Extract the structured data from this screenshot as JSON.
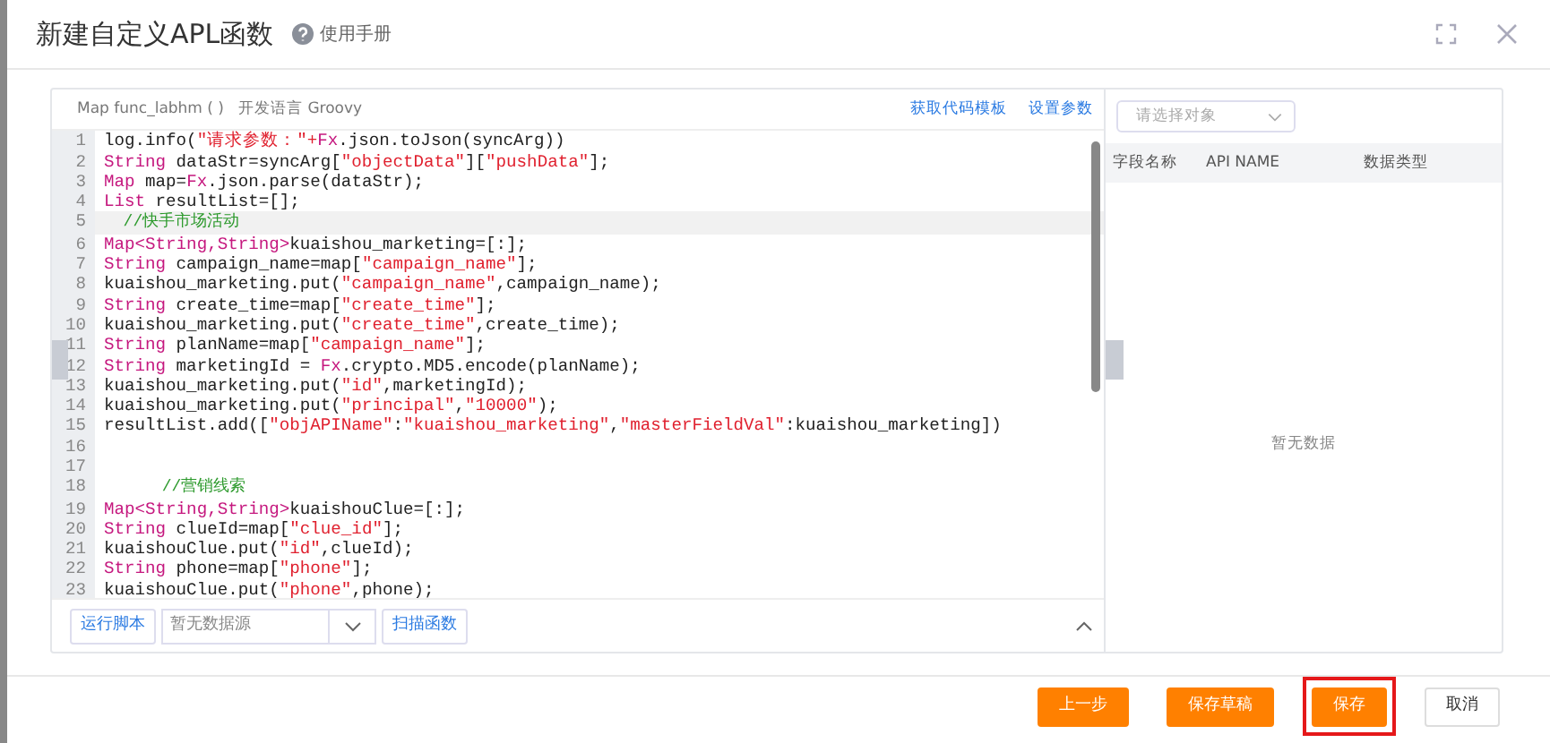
{
  "window": {
    "title": "新建自定义APL函数",
    "help_link": "使用手册"
  },
  "editor": {
    "signature": "Map func_labhm ( )",
    "language_label": "开发语言 Groovy",
    "links": [
      "获取代码模板",
      "设置参数"
    ],
    "lines": [
      {
        "no": "1",
        "highlighted": false,
        "tokens": [
          {
            "kind": "plain",
            "text": "log.info("
          },
          {
            "kind": "string",
            "text": "\"请求参数：\"+"
          },
          {
            "kind": "keyword",
            "text": "Fx"
          },
          {
            "kind": "plain",
            "text": ".json.toJson(syncArg))"
          }
        ]
      },
      {
        "no": "2",
        "highlighted": false,
        "tokens": [
          {
            "kind": "keyword",
            "text": "String"
          },
          {
            "kind": "plain",
            "text": " dataStr=syncArg["
          },
          {
            "kind": "string",
            "text": "\"objectData\""
          },
          {
            "kind": "plain",
            "text": "]["
          },
          {
            "kind": "string",
            "text": "\"pushData\""
          },
          {
            "kind": "plain",
            "text": "];"
          }
        ]
      },
      {
        "no": "3",
        "highlighted": false,
        "tokens": [
          {
            "kind": "keyword",
            "text": "Map"
          },
          {
            "kind": "plain",
            "text": " map="
          },
          {
            "kind": "keyword",
            "text": "Fx"
          },
          {
            "kind": "plain",
            "text": ".json.parse(dataStr);"
          }
        ]
      },
      {
        "no": "4",
        "highlighted": false,
        "tokens": [
          {
            "kind": "keyword",
            "text": "List"
          },
          {
            "kind": "plain",
            "text": " resultList=[];"
          }
        ]
      },
      {
        "no": "5",
        "highlighted": true,
        "tokens": [
          {
            "kind": "comment",
            "text": "  //快手市场活动"
          }
        ]
      },
      {
        "no": "6",
        "highlighted": false,
        "tokens": [
          {
            "kind": "keyword",
            "text": "Map<String,String>"
          },
          {
            "kind": "plain",
            "text": "kuaishou_marketing=[:];"
          }
        ]
      },
      {
        "no": "7",
        "highlighted": false,
        "tokens": [
          {
            "kind": "keyword",
            "text": "String"
          },
          {
            "kind": "plain",
            "text": " campaign_name=map["
          },
          {
            "kind": "string",
            "text": "\"campaign_name\""
          },
          {
            "kind": "plain",
            "text": "];"
          }
        ]
      },
      {
        "no": "8",
        "highlighted": false,
        "tokens": [
          {
            "kind": "plain",
            "text": "kuaishou_marketing.put("
          },
          {
            "kind": "string",
            "text": "\"campaign_name\""
          },
          {
            "kind": "plain",
            "text": ",campaign_name);"
          }
        ]
      },
      {
        "no": "9",
        "highlighted": false,
        "tokens": [
          {
            "kind": "keyword",
            "text": "String"
          },
          {
            "kind": "plain",
            "text": " create_time=map["
          },
          {
            "kind": "string",
            "text": "\"create_time\""
          },
          {
            "kind": "plain",
            "text": "];"
          }
        ]
      },
      {
        "no": "10",
        "highlighted": false,
        "tokens": [
          {
            "kind": "plain",
            "text": "kuaishou_marketing.put("
          },
          {
            "kind": "string",
            "text": "\"create_time\""
          },
          {
            "kind": "plain",
            "text": ",create_time);"
          }
        ]
      },
      {
        "no": "11",
        "highlighted": false,
        "tokens": [
          {
            "kind": "keyword",
            "text": "String"
          },
          {
            "kind": "plain",
            "text": " planName=map["
          },
          {
            "kind": "string",
            "text": "\"campaign_name\""
          },
          {
            "kind": "plain",
            "text": "];"
          }
        ]
      },
      {
        "no": "12",
        "highlighted": false,
        "tokens": [
          {
            "kind": "keyword",
            "text": "String"
          },
          {
            "kind": "plain",
            "text": " marketingId = "
          },
          {
            "kind": "keyword",
            "text": "Fx"
          },
          {
            "kind": "plain",
            "text": ".crypto.MD5.encode(planName);"
          }
        ]
      },
      {
        "no": "13",
        "highlighted": false,
        "tokens": [
          {
            "kind": "plain",
            "text": "kuaishou_marketing.put("
          },
          {
            "kind": "string",
            "text": "\"id\""
          },
          {
            "kind": "plain",
            "text": ",marketingId);"
          }
        ]
      },
      {
        "no": "14",
        "highlighted": false,
        "tokens": [
          {
            "kind": "plain",
            "text": "kuaishou_marketing.put("
          },
          {
            "kind": "string",
            "text": "\"principal\""
          },
          {
            "kind": "plain",
            "text": ","
          },
          {
            "kind": "string",
            "text": "\"10000\""
          },
          {
            "kind": "plain",
            "text": ");"
          }
        ]
      },
      {
        "no": "15",
        "highlighted": false,
        "tokens": [
          {
            "kind": "plain",
            "text": "resultList.add(["
          },
          {
            "kind": "string",
            "text": "\"objAPIName\""
          },
          {
            "kind": "plain",
            "text": ":"
          },
          {
            "kind": "string",
            "text": "\"kuaishou_marketing\""
          },
          {
            "kind": "plain",
            "text": ","
          },
          {
            "kind": "string",
            "text": "\"masterFieldVal\""
          },
          {
            "kind": "plain",
            "text": ":kuaishou_marketing])"
          }
        ]
      },
      {
        "no": "16",
        "highlighted": false
      },
      {
        "no": "17",
        "highlighted": false
      },
      {
        "no": "18",
        "highlighted": false,
        "tokens": [
          {
            "kind": "comment",
            "text": "      //营销线索"
          }
        ]
      },
      {
        "no": "19",
        "highlighted": false,
        "tokens": [
          {
            "kind": "keyword",
            "text": "Map<String,String>"
          },
          {
            "kind": "plain",
            "text": "kuaishouClue=[:];"
          }
        ]
      },
      {
        "no": "20",
        "highlighted": false,
        "tokens": [
          {
            "kind": "keyword",
            "text": "String"
          },
          {
            "kind": "plain",
            "text": " clueId=map["
          },
          {
            "kind": "string",
            "text": "\"clue_id\""
          },
          {
            "kind": "plain",
            "text": "];"
          }
        ]
      },
      {
        "no": "21",
        "highlighted": false,
        "tokens": [
          {
            "kind": "plain",
            "text": "kuaishouClue.put("
          },
          {
            "kind": "string",
            "text": "\"id\""
          },
          {
            "kind": "plain",
            "text": ",clueId);"
          }
        ]
      },
      {
        "no": "22",
        "highlighted": false,
        "tokens": [
          {
            "kind": "keyword",
            "text": "String"
          },
          {
            "kind": "plain",
            "text": " phone=map["
          },
          {
            "kind": "string",
            "text": "\"phone\""
          },
          {
            "kind": "plain",
            "text": "];"
          }
        ]
      },
      {
        "no": "23",
        "highlighted": false,
        "tokens": [
          {
            "kind": "plain",
            "text": "kuaishouClue.put("
          },
          {
            "kind": "string",
            "text": "\"phone\""
          },
          {
            "kind": "plain",
            "text": ",phone);"
          }
        ]
      }
    ],
    "run_button": "运行脚本",
    "datasource_select": {
      "value": "暂无数据源"
    },
    "scan_button": "扫描函数"
  },
  "object_panel": {
    "select": {
      "placeholder": "请选择对象"
    },
    "columns": [
      "字段名称",
      "API NAME",
      "数据类型"
    ],
    "empty_text": "暂无数据"
  },
  "footer": {
    "buttons": [
      {
        "label": "上一步",
        "kind": "primary",
        "focused": false
      },
      {
        "label": "保存草稿",
        "kind": "primary",
        "focused": false
      },
      {
        "label": "保存",
        "kind": "primary",
        "focused": true
      },
      {
        "label": "取消",
        "kind": "secondary",
        "focused": false
      }
    ]
  }
}
